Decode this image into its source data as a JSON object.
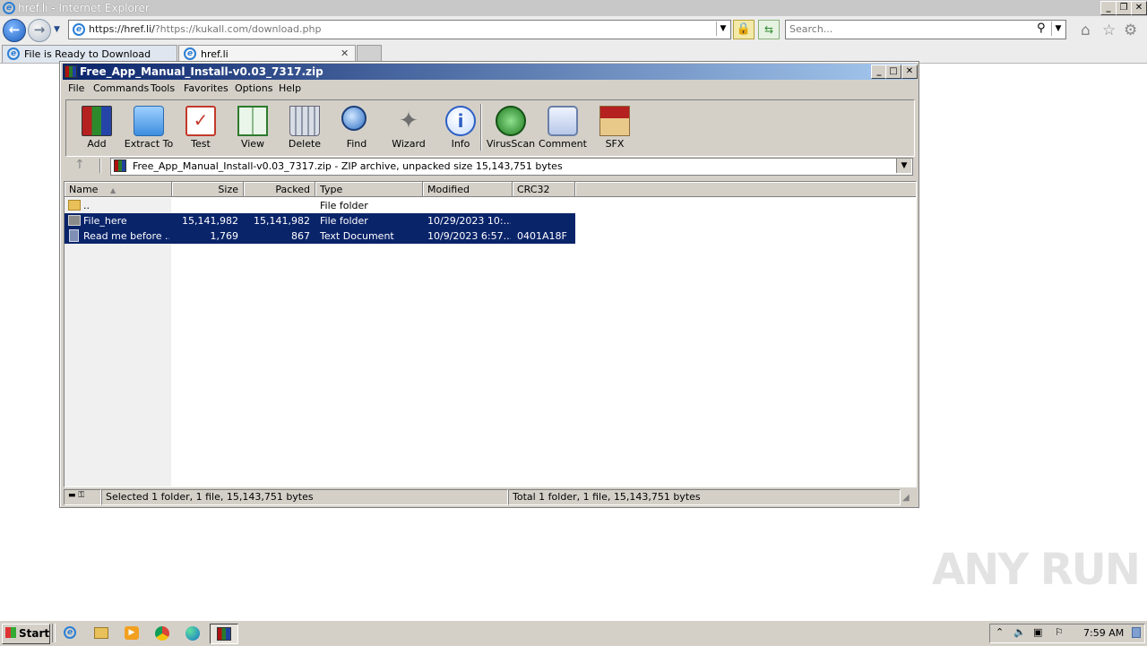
{
  "browser": {
    "window_title": "href.li - Internet Explorer",
    "address_main": "https://href.li/",
    "address_rest": "?https://kukall.com/download.php",
    "search_placeholder": "Search...",
    "tabs": [
      {
        "label": "File is Ready to Download"
      },
      {
        "label": "href.li"
      }
    ]
  },
  "winrar": {
    "title": "Free_App_Manual_Install-v0.03_7317.zip",
    "menu": [
      "File",
      "Commands",
      "Tools",
      "Favorites",
      "Options",
      "Help"
    ],
    "toolbar": [
      "Add",
      "Extract To",
      "Test",
      "View",
      "Delete",
      "Find",
      "Wizard",
      "Info",
      "VirusScan",
      "Comment",
      "SFX"
    ],
    "path": "Free_App_Manual_Install-v0.03_7317.zip - ZIP archive, unpacked size 15,143,751 bytes",
    "columns": [
      "Name",
      "Size",
      "Packed",
      "Type",
      "Modified",
      "CRC32"
    ],
    "rows": [
      {
        "name": "..",
        "size": "",
        "packed": "",
        "type": "File folder",
        "modified": "",
        "crc": "",
        "selected": false
      },
      {
        "name": "File_here",
        "size": "15,141,982",
        "packed": "15,141,982",
        "type": "File folder",
        "modified": "10/29/2023 10:...",
        "crc": "",
        "selected": true
      },
      {
        "name": "Read me before ...",
        "size": "1,769",
        "packed": "867",
        "type": "Text Document",
        "modified": "10/9/2023 6:57...",
        "crc": "0401A18F",
        "selected": true
      }
    ],
    "status_left": "Selected 1 folder, 1 file, 15,143,751 bytes",
    "status_right": "Total 1 folder, 1 file, 15,143,751 bytes"
  },
  "taskbar": {
    "start_label": "Start",
    "clock": "7:59 AM"
  },
  "watermark": "ANY RUN",
  "colors": {
    "selection": "#0a246a",
    "ie_accent": "#2b7fd6",
    "titlebar_gradient_start": "#0a246a",
    "titlebar_gradient_end": "#a6caf0"
  }
}
